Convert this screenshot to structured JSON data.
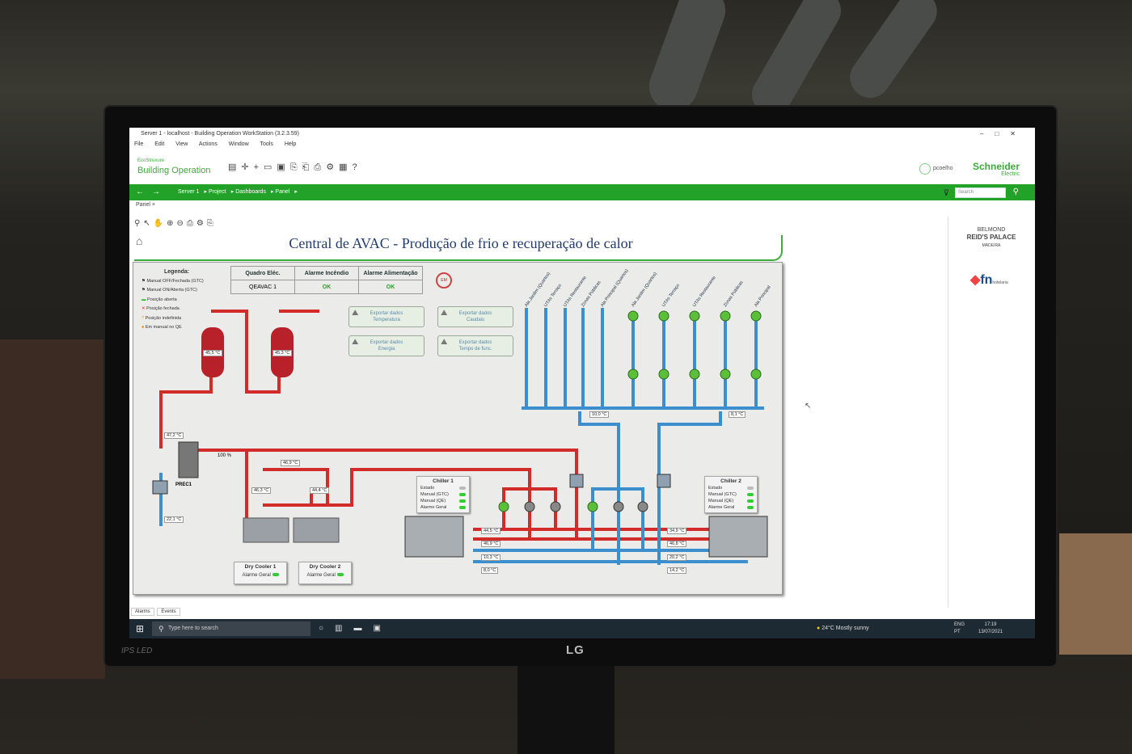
{
  "window": {
    "title": "Server 1 - localhost - Building Operation WorkStation (3.2.3.59)"
  },
  "menu": [
    "File",
    "Edit",
    "View",
    "Actions",
    "Window",
    "Tools",
    "Help"
  ],
  "brand": {
    "eco": "EcoStruxure",
    "product": "Building Operation",
    "vendor": "Schneider",
    "vendor_sub": "Electric"
  },
  "user": {
    "name": "pcoelho"
  },
  "breadcrumb": [
    "Server 1",
    "Project",
    "Dashboards",
    "Panel"
  ],
  "search": {
    "placeholder": "Search"
  },
  "tab": {
    "label": "Panel"
  },
  "page_title": "Central de AVAC - Produção de frio e recuperação de calor",
  "legend": {
    "title": "Legenda:",
    "items": [
      "Manual OFF/Fechada (GTC)",
      "Manual ON/Aberta (GTC)",
      "Posição aberta",
      "Posição fechada",
      "Posição indefinida",
      "Em manual no QE"
    ]
  },
  "status_table": {
    "headers": [
      "Quadro Eléc.",
      "Alarme Incêndio",
      "Alarme Alimentação"
    ],
    "values": [
      "QEAVAC 1",
      "OK",
      "OK"
    ]
  },
  "em_label": "EM",
  "export_buttons": [
    {
      "line1": "Exportar dados",
      "line2": "Temperatura"
    },
    {
      "line1": "Exportar dados",
      "line2": "Caudais"
    },
    {
      "line1": "Exportar dados",
      "line2": "Energia"
    },
    {
      "line1": "Exportar dados",
      "line2": "Tempo de func."
    }
  ],
  "zones": [
    "Ala Jardim (Quartos)",
    "UTAs Terraço",
    "UTAs Restaurante",
    "Zonas Públicas",
    "Ala Principal (Quartos)",
    "Ala Jardim (Quartos)",
    "UTAs Terraço",
    "UTAs Restaurante",
    "Zonas Públicas",
    "Ala Principal"
  ],
  "temps": {
    "tank1": "45,5 °C",
    "tank2": "45,3 °C",
    "t_472": "47,2 °C",
    "t_469": "46,9 °C",
    "t_463": "46,3 °C",
    "t_444": "44,4 °C",
    "t_221": "22,1 °C",
    "valve_pct": "100 %",
    "cold_supply": "10,0 °C",
    "cold_return": "8,1 °C",
    "c1_a": "44,5 °C",
    "c1_b": "46,9 °C",
    "c1_c": "10,3 °C",
    "c1_d": "8,0 °C",
    "c2_a": "34,9 °C",
    "c2_b": "46,8 °C",
    "c2_c": "20,2 °C",
    "c2_d": "14,2 °C"
  },
  "prec_label": "PREC1",
  "chiller1": {
    "name": "Chiller 1",
    "rows": [
      "Estado",
      "Manual (GTC)",
      "Manual (QE)",
      "Alarme Geral"
    ]
  },
  "chiller2": {
    "name": "Chiller 2",
    "rows": [
      "Estado",
      "Manual (GTC)",
      "Manual (QE)",
      "Alarme Geral"
    ]
  },
  "dry_cooler1": {
    "name": "Dry Cooler 1",
    "row": "Alarme Geral"
  },
  "dry_cooler2": {
    "name": "Dry Cooler 2",
    "row": "Alarme Geral"
  },
  "side_brand": {
    "line1": "BELMOND",
    "line2": "REID'S PALACE",
    "line3": "MADEIRA",
    "fn": "fn",
    "fn_sub": "hotelaria"
  },
  "bottom_tabs": [
    "Alarms",
    "Events"
  ],
  "taskbar": {
    "search": "Type here to search",
    "weather": "24°C  Mostly sunny",
    "lang1": "ENG",
    "lang2": "PT",
    "time": "17:19",
    "date": "13/07/2021"
  },
  "monitor": {
    "brand": "LG",
    "panel": "IPS LED"
  },
  "colors": {
    "accent": "#23a22a",
    "hot_pipe": "#d32a2a",
    "cold_pipe": "#3b8fcf",
    "title": "#223a6e"
  }
}
